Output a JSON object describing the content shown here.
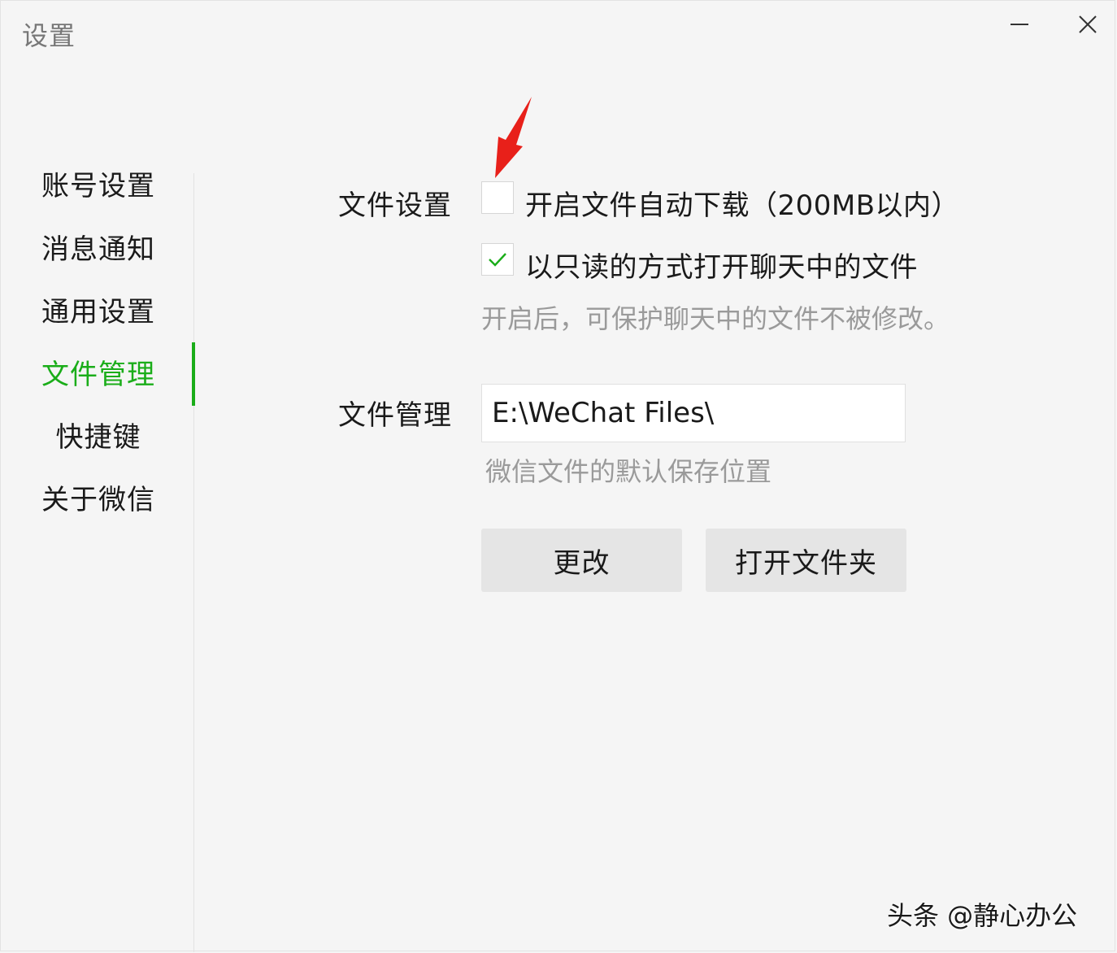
{
  "window": {
    "title": "设置",
    "minimize_icon": "minimize-icon",
    "close_icon": "close-icon"
  },
  "sidebar": {
    "items": [
      {
        "label": "账号设置",
        "active": false
      },
      {
        "label": "消息通知",
        "active": false
      },
      {
        "label": "通用设置",
        "active": false
      },
      {
        "label": "文件管理",
        "active": true
      },
      {
        "label": "快捷键",
        "active": false
      },
      {
        "label": "关于微信",
        "active": false
      }
    ],
    "active_color": "#1aad19"
  },
  "file_settings": {
    "label": "文件设置",
    "auto_download": {
      "label": "开启文件自动下载（200MB以内）",
      "checked": false
    },
    "read_only": {
      "label": "以只读的方式打开聊天中的文件",
      "checked": true
    },
    "read_only_hint": "开启后，可保护聊天中的文件不被修改。"
  },
  "file_management": {
    "label": "文件管理",
    "path_value": "E:\\WeChat Files\\",
    "path_hint": "微信文件的默认保存位置",
    "change_button": "更改",
    "open_folder_button": "打开文件夹"
  },
  "annotation": {
    "arrow_color": "#e8201a"
  },
  "watermark": {
    "text": "头条 @静心办公"
  }
}
